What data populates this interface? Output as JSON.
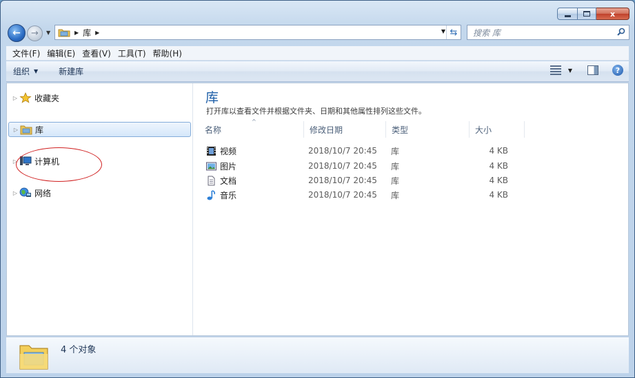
{
  "window": {
    "close_glyph": "x",
    "back_glyph": "←",
    "forward_glyph": "→"
  },
  "address": {
    "path_label": "库",
    "refresh_glyph": "⇆"
  },
  "search": {
    "placeholder": "搜索 库"
  },
  "menu": {
    "items": [
      "文件(F)",
      "编辑(E)",
      "查看(V)",
      "工具(T)",
      "帮助(H)"
    ]
  },
  "toolbar": {
    "organize_label": "组织",
    "new_library_label": "新建库",
    "help_glyph": "?"
  },
  "nav": {
    "favorites": "收藏夹",
    "libraries": "库",
    "computer": "计算机",
    "network": "网络"
  },
  "main": {
    "title": "库",
    "description": "打开库以查看文件并根据文件夹、日期和其他属性排列这些文件。",
    "columns": {
      "name": "名称",
      "date": "修改日期",
      "type": "类型",
      "size": "大小"
    },
    "rows": [
      {
        "name": "视频",
        "date": "2018/10/7 20:45",
        "type": "库",
        "size": "4 KB",
        "icon": "video-library-icon"
      },
      {
        "name": "图片",
        "date": "2018/10/7 20:45",
        "type": "库",
        "size": "4 KB",
        "icon": "pictures-library-icon"
      },
      {
        "name": "文档",
        "date": "2018/10/7 20:45",
        "type": "库",
        "size": "4 KB",
        "icon": "documents-library-icon"
      },
      {
        "name": "音乐",
        "date": "2018/10/7 20:45",
        "type": "库",
        "size": "4 KB",
        "icon": "music-library-icon"
      }
    ]
  },
  "status": {
    "count_text": "4 个对象"
  },
  "colors": {
    "title_blue": "#1e5fa8",
    "annotation_red": "#d02020",
    "folder_yellow": "#f3cf5a"
  }
}
